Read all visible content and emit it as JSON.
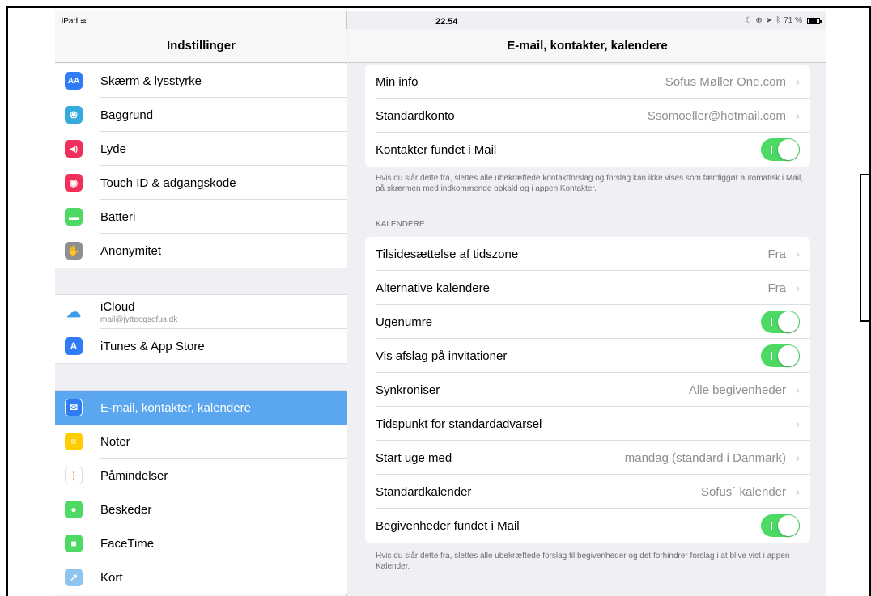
{
  "status": {
    "device": "iPad",
    "time": "22.54",
    "battery": "71 %"
  },
  "sidebar": {
    "title": "Indstillinger",
    "items": [
      {
        "label": "Skærm & lysstyrke",
        "icon": "display-icon",
        "color": "#2f7cf6",
        "glyph": "AA"
      },
      {
        "label": "Baggrund",
        "icon": "wallpaper-icon",
        "color": "#35aadc",
        "glyph": "❀"
      },
      {
        "label": "Lyde",
        "icon": "sounds-icon",
        "color": "#f0305a",
        "glyph": "◀)"
      },
      {
        "label": "Touch ID & adgangskode",
        "icon": "fingerprint-icon",
        "color": "#f0305a",
        "glyph": "◉"
      },
      {
        "label": "Batteri",
        "icon": "battery-icon",
        "color": "#4cd964",
        "glyph": "▬"
      },
      {
        "label": "Anonymitet",
        "icon": "hand-icon",
        "color": "#8e8e93",
        "glyph": "✋"
      }
    ],
    "icloud": {
      "label": "iCloud",
      "sub": "mail@jytteogsofus.dk",
      "icon": "cloud-icon",
      "color": "#ffffff"
    },
    "store": {
      "label": "iTunes & App Store",
      "icon": "app-store-icon",
      "color": "#2f7cf6",
      "glyph": "A"
    },
    "items2": [
      {
        "label": "E-mail, kontakter, kalendere",
        "icon": "mail-icon",
        "color": "#2f7cf6",
        "glyph": "✉"
      },
      {
        "label": "Noter",
        "icon": "notes-icon",
        "color": "#ffcc00",
        "glyph": "≡"
      },
      {
        "label": "Påmindelser",
        "icon": "reminders-icon",
        "color": "#ffffff",
        "glyph": "⋮"
      },
      {
        "label": "Beskeder",
        "icon": "messages-icon",
        "color": "#4cd964",
        "glyph": "●"
      },
      {
        "label": "FaceTime",
        "icon": "facetime-icon",
        "color": "#4cd964",
        "glyph": "■"
      },
      {
        "label": "Kort",
        "icon": "maps-icon",
        "color": "#8ec5f0",
        "glyph": "↗"
      }
    ]
  },
  "detail": {
    "title": "E-mail, kontakter, kalendere",
    "contacts": [
      {
        "label": "Min info",
        "value": "Sofus Møller One.com"
      },
      {
        "label": "Standardkonto",
        "value": "Ssomoeller@hotmail.com"
      },
      {
        "label": "Kontakter fundet i Mail",
        "toggle": true
      }
    ],
    "contacts_footer": "Hvis du slår dette fra, slettes alle ubekræftede kontaktforslag og forslag kan ikke vises som færdiggør automatisk i Mail, på skærmen med indkommende opkald og i appen Kontakter.",
    "calendar_section": "KALENDERE",
    "calendar": [
      {
        "label": "Tilsidesættelse af tidszone",
        "value": "Fra"
      },
      {
        "label": "Alternative kalendere",
        "value": "Fra"
      },
      {
        "label": "Ugenumre",
        "toggle": true
      },
      {
        "label": "Vis afslag på invitationer",
        "toggle": true
      },
      {
        "label": "Synkroniser",
        "value": "Alle begivenheder"
      },
      {
        "label": "Tidspunkt for standardadvarsel",
        "value": ""
      },
      {
        "label": "Start uge med",
        "value": "mandag (standard i Danmark)"
      },
      {
        "label": "Standardkalender",
        "value": "Sofus´ kalender"
      },
      {
        "label": "Begivenheder fundet i Mail",
        "toggle": true
      }
    ],
    "calendar_footer": "Hvis du slår dette fra, slettes alle ubekræftede forslag til begivenheder og det forhindrer forslag i at blive vist i appen Kalender."
  }
}
